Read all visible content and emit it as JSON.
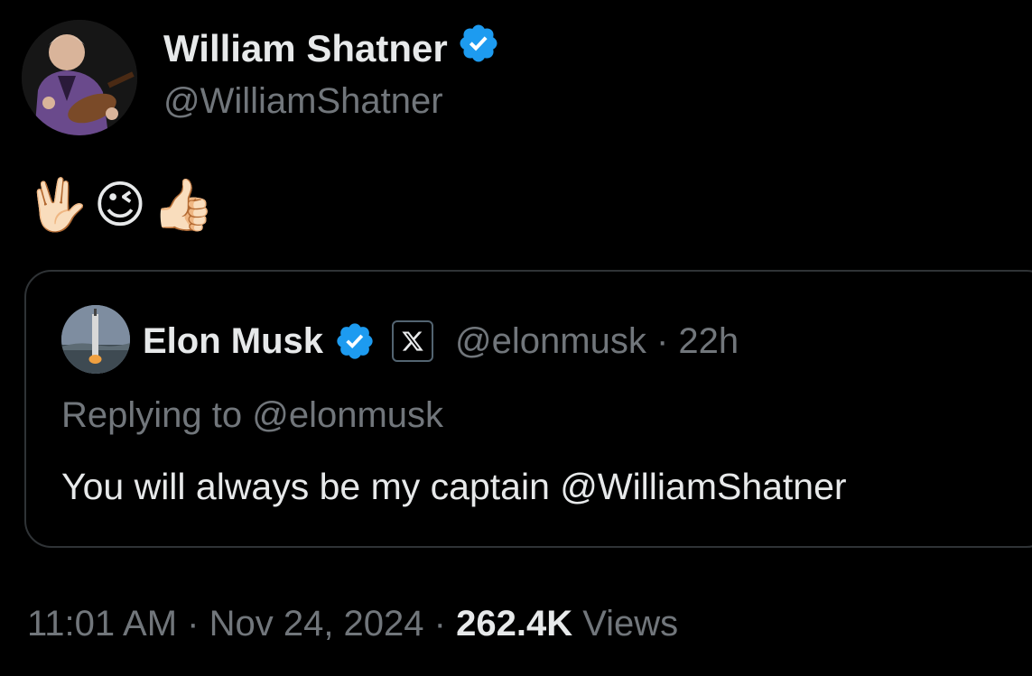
{
  "tweet": {
    "author": {
      "name": "William Shatner",
      "handle": "@WilliamShatner",
      "verified": true,
      "avatar": "user-avatar-guitar-photo"
    },
    "body_emojis": [
      "🖖🏻",
      "😉",
      "👍🏻"
    ],
    "quoted": {
      "author_name": "Elon Musk",
      "verified": true,
      "affiliate_badge": "x-logo-icon",
      "handle": "@elonmusk",
      "separator": "·",
      "time": "22h",
      "replying_to_prefix": "Replying to ",
      "replying_to_handle": "@elonmusk",
      "text": "You will always be my captain @WilliamShatner"
    },
    "meta": {
      "time": "11:01 AM",
      "separator": " · ",
      "date": "Nov 24, 2024",
      "separator2": " · ",
      "views_count": "262.4K",
      "views_label": " Views"
    }
  },
  "colors": {
    "background": "#000000",
    "primary_text": "#e7e9ea",
    "secondary_text": "#71767b",
    "verified_blue": "#1d9bf0",
    "border": "#2f3336"
  }
}
